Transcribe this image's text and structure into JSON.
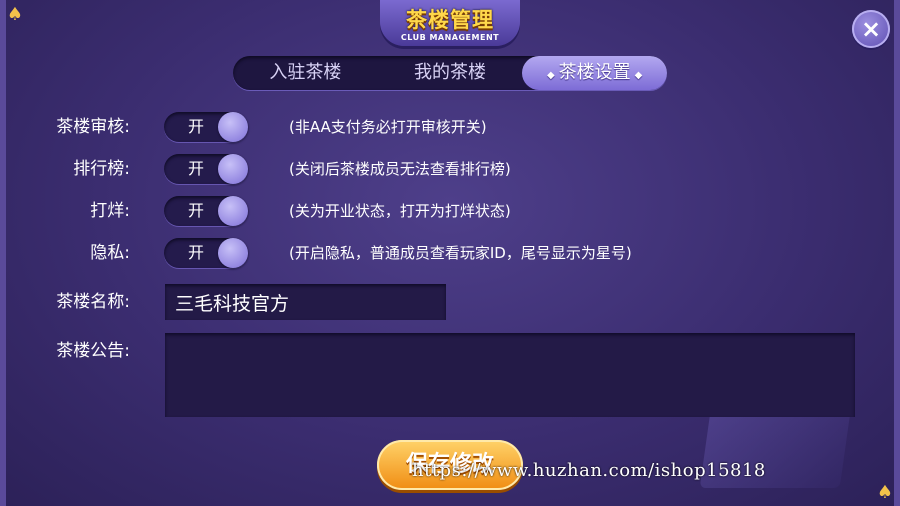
{
  "header": {
    "title": "茶楼管理",
    "subtitle": "CLUB MANAGEMENT",
    "close_label": "×"
  },
  "tabs": [
    {
      "label": "入驻茶楼",
      "active": false
    },
    {
      "label": "我的茶楼",
      "active": false
    },
    {
      "label": "茶楼设置",
      "active": true
    }
  ],
  "settings": [
    {
      "label": "茶楼审核:",
      "toggle": "开",
      "desc": "(非AA支付务必打开审核开关)"
    },
    {
      "label": "排行榜:",
      "toggle": "开",
      "desc": "(关闭后茶楼成员无法查看排行榜)"
    },
    {
      "label": "打烊:",
      "toggle": "开",
      "desc": "(关为开业状态，打开为打烊状态)"
    },
    {
      "label": "隐私:",
      "toggle": "开",
      "desc": "(开启隐私，普通成员查看玩家ID，尾号显示为星号)"
    }
  ],
  "club_name": {
    "label": "茶楼名称:",
    "value": "三毛科技官方"
  },
  "club_notice": {
    "label": "茶楼公告:",
    "value": ""
  },
  "save_label": "保存修改",
  "watermark": "https://www.huzhan.com/ishop15818",
  "colors": {
    "accent": "#ffd84a",
    "button": "#f08c12",
    "tab_active": "#9a8ce6"
  }
}
